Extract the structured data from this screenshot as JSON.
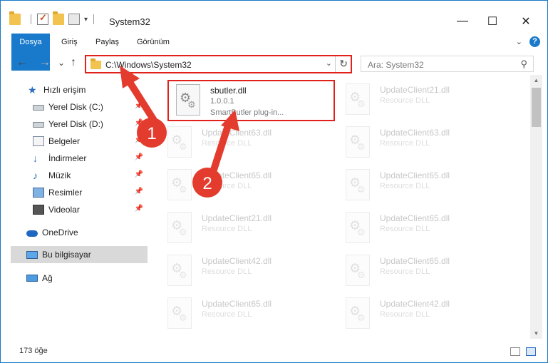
{
  "window": {
    "title": "System32",
    "controls": {
      "minimize": "—",
      "maximize": "☐",
      "close": "✕"
    }
  },
  "ribbon": {
    "tabs": [
      "Dosya",
      "Giriş",
      "Paylaş",
      "Görünüm"
    ],
    "help": "?"
  },
  "navigation": {
    "back_glyph": "←",
    "forward_glyph": "→",
    "recent_glyph": "⌄",
    "up_glyph": "↑",
    "address": "C:\\Windows\\System32",
    "refresh_glyph": "↻",
    "search_placeholder": "Ara: System32",
    "search_icon": "search-icon"
  },
  "sidebar": {
    "items": [
      {
        "label": "Hızlı erişim",
        "icon": "star-icon",
        "pinned": false
      },
      {
        "label": "Yerel Disk (C:)",
        "icon": "drive-icon",
        "pinned": true
      },
      {
        "label": "Yerel Disk (D:)",
        "icon": "drive-icon",
        "pinned": true
      },
      {
        "label": "Belgeler",
        "icon": "documents-icon",
        "pinned": true
      },
      {
        "label": "İndirmeler",
        "icon": "download-icon",
        "pinned": true
      },
      {
        "label": "Müzik",
        "icon": "music-icon",
        "pinned": true
      },
      {
        "label": "Resimler",
        "icon": "pictures-icon",
        "pinned": true
      },
      {
        "label": "Videolar",
        "icon": "videos-icon",
        "pinned": true
      },
      {
        "label": "OneDrive",
        "icon": "cloud-icon",
        "pinned": false
      },
      {
        "label": "Bu bilgisayar",
        "icon": "computer-icon",
        "pinned": false,
        "selected": true
      },
      {
        "label": "Ağ",
        "icon": "network-icon",
        "pinned": false
      }
    ]
  },
  "files": [
    {
      "name": "sbutler.dll",
      "line1": "1.0.0.1",
      "line2": "SmartButler plug-in...",
      "highlighted": true
    },
    {
      "name": "UpdateClient21.dll",
      "line1": "Resource DLL"
    },
    {
      "name": "UpdateClient63.dll",
      "line1": "Resource DLL"
    },
    {
      "name": "UpdateClient63.dll",
      "line1": "Resource DLL"
    },
    {
      "name": "UpdateClient65.dll",
      "line1": "Resource DLL"
    },
    {
      "name": "UpdateClient65.dll",
      "line1": "Resource DLL"
    },
    {
      "name": "UpdateClient21.dll",
      "line1": "Resource DLL"
    },
    {
      "name": "UpdateClient65.dll",
      "line1": "Resource DLL"
    },
    {
      "name": "UpdateClient42.dll",
      "line1": "Resource DLL"
    },
    {
      "name": "UpdateClient65.dll",
      "line1": "Resource DLL"
    },
    {
      "name": "UpdateClient65.dll",
      "line1": "Resource DLL"
    },
    {
      "name": "UpdateClient42.dll",
      "line1": "Resource DLL"
    }
  ],
  "status": {
    "item_count": "173 öğe"
  },
  "annotations": {
    "step1": "1",
    "step2": "2",
    "color": "#e33b2e"
  },
  "colors": {
    "accent": "#1979ca",
    "highlight_border": "#e0211c"
  }
}
